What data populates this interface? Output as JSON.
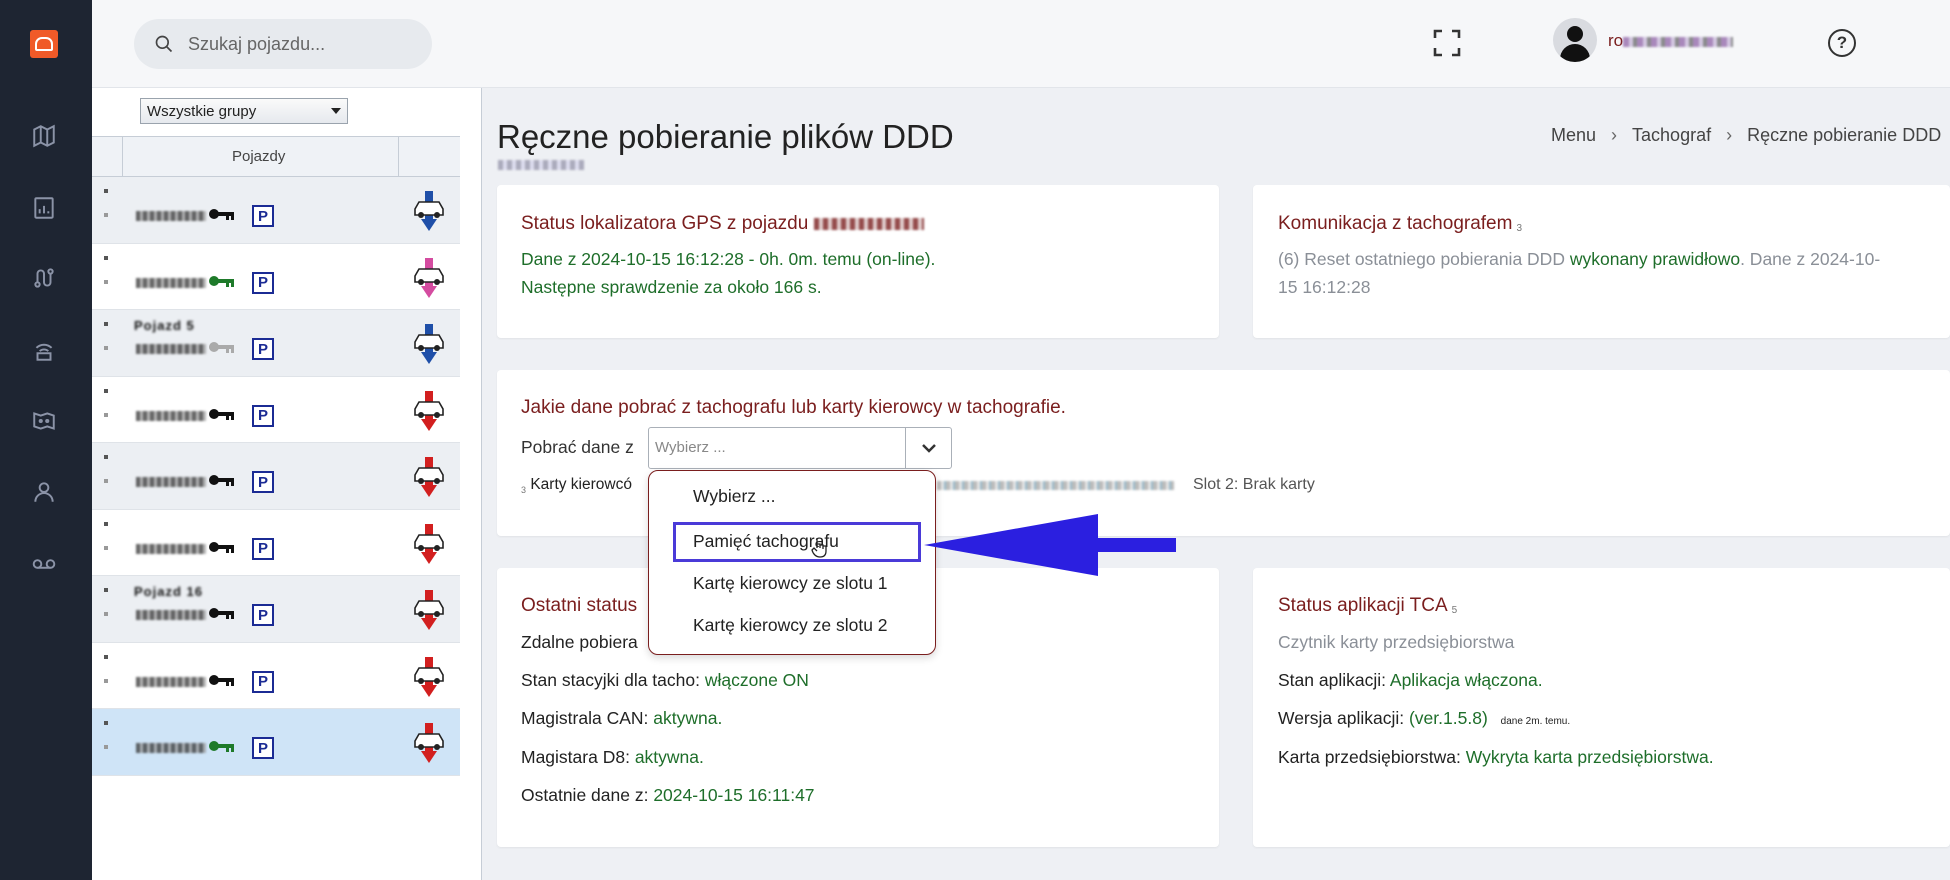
{
  "search": {
    "placeholder": "Szukaj pojazdu..."
  },
  "user": {
    "name": "ro"
  },
  "help": {
    "label": "?"
  },
  "vehicle_panel": {
    "group_select": "Wszystkie grupy",
    "column_header": "Pojazdy",
    "rows": [
      {
        "name": "",
        "selected": false
      },
      {
        "name": "",
        "selected": false
      },
      {
        "name": "Pojazd 5",
        "selected": false
      },
      {
        "name": "",
        "selected": false
      },
      {
        "name": "",
        "selected": false
      },
      {
        "name": "",
        "selected": false
      },
      {
        "name": "Pojazd 16",
        "selected": false
      },
      {
        "name": "",
        "selected": false
      },
      {
        "name": "",
        "selected": true
      }
    ],
    "parking_label": "P"
  },
  "page": {
    "title": "Ręczne pobieranie plików DDD",
    "breadcrumb": [
      "Menu",
      "Tachograf",
      "Ręczne pobieranie DDD"
    ]
  },
  "gps_card": {
    "title": "Status lokalizatora GPS z pojazdu",
    "line1": "Dane z 2024-10-15 16:12:28 - 0h. 0m. temu (on-line).",
    "line2": "Następne sprawdzenie za około 166 s."
  },
  "comm_card": {
    "title": "Komunikacja z tachografem",
    "badge": "3",
    "prefix": "(6) Reset ostatniego pobierania DDD",
    "status": "wykonany prawidłowo",
    "suffix": ". Dane z 2024-10-",
    "line2": "15 16:12:28"
  },
  "download_card": {
    "title": "Jakie dane pobrać z tachografu lub karty kierowcy w tachografie.",
    "label": "Pobrać dane z",
    "select_value": "Wybierz ...",
    "cards_badge": "3",
    "cards_label": "Karty kierowcó",
    "slot2": "Slot 2: Brak karty",
    "options": [
      "Wybierz ...",
      "Pamięć tachografu",
      "Kartę kierowcy ze slotu 1",
      "Kartę kierowcy ze slotu 2"
    ],
    "highlighted_option": "Pamięć tachografu"
  },
  "status_card": {
    "title": "Ostatni status",
    "remote": "Zdalne pobiera",
    "ignition_label": "Stan stacyjki dla tacho:",
    "ignition_value": "włączone ON",
    "can_label": "Magistrala CAN:",
    "can_value": "aktywna.",
    "d8_label": "Magistara D8:",
    "d8_value": "aktywna.",
    "last_label": "Ostatnie dane z:",
    "last_value": "2024-10-15 16:11:47"
  },
  "tca_card": {
    "title": "Status aplikacji TCA",
    "badge": "5",
    "subtitle": "Czytnik karty przedsiębiorstwa",
    "app_label": "Stan aplikacji:",
    "app_value": "Aplikacja włączona.",
    "ver_label": "Wersja aplikacji:",
    "ver_value": "(ver.1.5.8)",
    "ver_note": "dane 2m. temu.",
    "card_label": "Karta przedsiębiorstwa:",
    "card_value": "Wykryta karta przedsiębiorstwa."
  },
  "colors": {
    "nav_bg": "#1e2532",
    "accent": "#7a1e1e",
    "ok_green": "#1e6e2a",
    "highlight": "#4a3ad8",
    "arrow": "#2b1fe0"
  }
}
